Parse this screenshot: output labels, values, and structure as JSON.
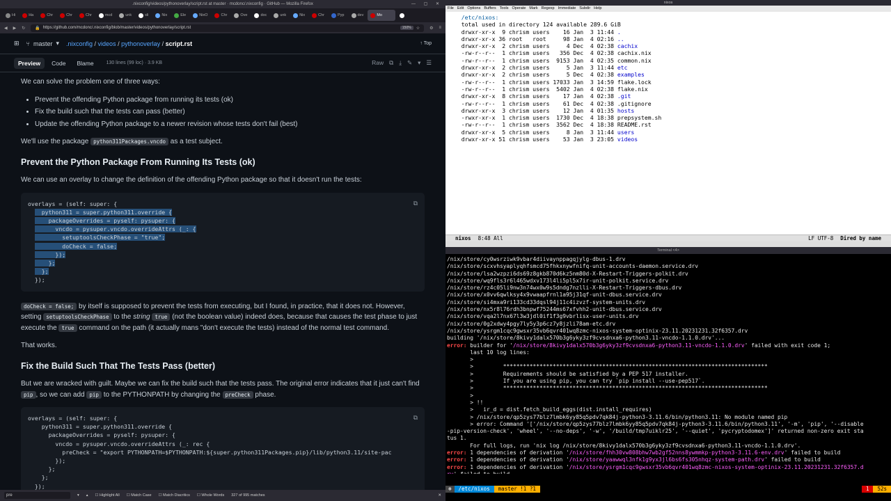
{
  "firefox": {
    "window_title": ".nixconfig/videos/pythonoverlay/script.rst at master · mcdonc/.nixconfig · GitHub — Mozilla Firefox",
    "tabs": [
      "Hi",
      "Ha",
      "Chr",
      "Chr",
      "Chr",
      "mcd",
      "unk",
      "sli",
      "Nix",
      "Ele",
      "NixO",
      "Chr",
      "Ove",
      "doc",
      "unk",
      "Nix",
      "Chr",
      "Pyp",
      "dev",
      "Mo",
      ""
    ],
    "url": "https://github.com/mcdonc/.nixconfig/blob/master/videos/pythonoverlay/script.rst",
    "zoom": "150%"
  },
  "github": {
    "branch": "master",
    "crumbs": [
      ".nixconfig",
      "videos",
      "pythonoverlay"
    ],
    "file": "script.rst",
    "top": "Top",
    "tabs": [
      "Preview",
      "Code",
      "Blame"
    ],
    "meta": "130 lines (99 loc) · 3.9 KB",
    "raw": "Raw"
  },
  "article": {
    "p1": "We can solve the problem one of three ways:",
    "list": [
      "Prevent the offending Python package from running its tests (ok)",
      "Fix the build such that the tests can pass (better)",
      "Update the offending Python package to a newer revision whose tests don't fail (best)"
    ],
    "p2a": "We'll use the package ",
    "p2code": "python311Packages.vncdo",
    "p2b": " as a test subject.",
    "h1": "Prevent the Python Package From Running Its Tests (ok)",
    "p3": "We can use an overlay to change the definition of the offending Python package so that it doesn't run the tests:",
    "code1": [
      "overlays = (self: super: {",
      "    python311 = super.python311.override {",
      "      packageOverrides = pyself: pysuper: {",
      "        vncdo = pysuper.vncdo.overrideAttrs (_: {",
      "          setuptoolsCheckPhase = \"true\";",
      "          doCheck = false;",
      "        });",
      "      };",
      "    };",
      "  });"
    ],
    "p4code1": "doCheck = false;",
    "p4a": " by itself is supposed to prevent the tests from executing, but I found, in practice, that it does not. However, setting ",
    "p4code2": "setuptoolsCheckPhase",
    "p4b": " to the ",
    "p4em": "string",
    "p4code3": "true",
    "p4c": " (not the boolean value) indeed does, because that causes the test phase to just execute the ",
    "p4code4": "true",
    "p4d": " command on the path (it actually mans \"don't execute the tests) instead of the normal test command.",
    "p5": "That works.",
    "h2": "Fix the Build Such That The Tests Pass (better)",
    "p6a": "But we are wracked with guilt. Maybe we can fix the build such that the tests pass. The original error indicates that it just can't find ",
    "p6code1": "pip",
    "p6b": ", so we can add ",
    "p6code2": "pip",
    "p6c": " to the PYTHONPATH by changing the ",
    "p6code3": "preCheck",
    "p6d": " phase.",
    "code2": [
      "overlays = (self: super: {",
      "    python311 = super.python311.override {",
      "      packageOverrides = pyself: pysuper: {",
      "        vncdo = pysuper.vncdo.overrideAttrs (_: rec {",
      "          preCheck = \"export PYTHONPATH=$PYTHONPATH:${super.python311Packages.pip}/lib/python3.11/site-pac",
      "        });",
      "      };",
      "    };",
      "  });"
    ]
  },
  "findbar": {
    "query": "pre",
    "highlight_all": "Highlight All",
    "match_case": "Match Case",
    "match_diacritics": "Match Diacritics",
    "whole_words": "Whole Words",
    "matches": "327 of 995 matches"
  },
  "emacs": {
    "title": "nixos",
    "menu": [
      "File",
      "Edit",
      "Options",
      "Buffers",
      "Tools",
      "Operate",
      "Mark",
      "Regexp",
      "Immediate",
      "Subdir",
      "Help"
    ],
    "header": "/etc/nixos:",
    "total": "total used in directory 124 available 289.6 GiB",
    "rows": [
      {
        "perm": "drwxr-xr-x",
        "n": " 9",
        "u": "chrism",
        "g": "users",
        "size": "   16",
        "date": "Jan  3 11:44",
        "name": ".",
        "dir": true
      },
      {
        "perm": "drwxr-xr-x",
        "n": "36",
        "u": "root  ",
        "g": "root ",
        "size": "   98",
        "date": "Jan  4 02:16",
        "name": "..",
        "dir": true
      },
      {
        "perm": "drwxr-xr-x",
        "n": " 2",
        "u": "chrism",
        "g": "users",
        "size": "    4",
        "date": "Dec  4 02:38",
        "name": "cachix",
        "dir": true
      },
      {
        "perm": "-rw-r--r--",
        "n": " 1",
        "u": "chrism",
        "g": "users",
        "size": "  356",
        "date": "Dec  4 02:38",
        "name": "cachix.nix",
        "dir": false
      },
      {
        "perm": "-rw-r--r--",
        "n": " 1",
        "u": "chrism",
        "g": "users",
        "size": " 9153",
        "date": "Jan  4 02:35",
        "name": "common.nix",
        "dir": false
      },
      {
        "perm": "drwxr-xr-x",
        "n": " 2",
        "u": "chrism",
        "g": "users",
        "size": "    5",
        "date": "Jan  3 11:44",
        "name": "etc",
        "dir": true
      },
      {
        "perm": "drwxr-xr-x",
        "n": " 2",
        "u": "chrism",
        "g": "users",
        "size": "    5",
        "date": "Dec  4 02:38",
        "name": "examples",
        "dir": true
      },
      {
        "perm": "-rw-r--r--",
        "n": " 1",
        "u": "chrism",
        "g": "users",
        "size": "17033",
        "date": "Jan  3 14:59",
        "name": "flake.lock",
        "dir": false
      },
      {
        "perm": "-rw-r--r--",
        "n": " 1",
        "u": "chrism",
        "g": "users",
        "size": " 5402",
        "date": "Jan  4 02:38",
        "name": "flake.nix",
        "dir": false
      },
      {
        "perm": "drwxr-xr-x",
        "n": " 8",
        "u": "chrism",
        "g": "users",
        "size": "   17",
        "date": "Jan  4 02:38",
        "name": ".git",
        "dir": true
      },
      {
        "perm": "-rw-r--r--",
        "n": " 1",
        "u": "chrism",
        "g": "users",
        "size": "   61",
        "date": "Dec  4 02:38",
        "name": ".gitignore",
        "dir": false
      },
      {
        "perm": "drwxr-xr-x",
        "n": " 3",
        "u": "chrism",
        "g": "users",
        "size": "   12",
        "date": "Jan  4 01:35",
        "name": "hosts",
        "dir": true
      },
      {
        "perm": "-rwxr-xr-x",
        "n": " 1",
        "u": "chrism",
        "g": "users",
        "size": " 1730",
        "date": "Dec  4 18:38",
        "name": "prepsystem.sh",
        "dir": false
      },
      {
        "perm": "-rw-r--r--",
        "n": " 1",
        "u": "chrism",
        "g": "users",
        "size": " 3562",
        "date": "Dec  4 18:38",
        "name": "README.rst",
        "dir": false
      },
      {
        "perm": "drwxr-xr-x",
        "n": " 5",
        "u": "chrism",
        "g": "users",
        "size": "    8",
        "date": "Jan  3 11:44",
        "name": "users",
        "dir": true
      },
      {
        "perm": "drwxr-xr-x",
        "n": "51",
        "u": "chrism",
        "g": "users",
        "size": "   53",
        "date": "Jan  3 23:05",
        "name": "videos",
        "dir": true
      }
    ],
    "mode_buffer": "nixos",
    "mode_pos": "8:48 All",
    "mode_enc": "LF UTF-8",
    "mode_major": "Dired by name"
  },
  "terminal": {
    "title": "Terminal <4>",
    "lines": [
      {
        "t": "/nix/store/cy0wsrziwk9vbar4diivaynppagqjylg-dbus-1.drv"
      },
      {
        "t": "/nix/store/scxvhsyaplyqhfsmcd75fhkxnywfnifq-unit-accounts-daemon.service.drv"
      },
      {
        "t": "/nix/store/lsa2wzpzi6ds69z8gkb870d6kz5nm80d-X-Restart-Triggers-polkit.drv"
      },
      {
        "t": "/nix/store/wq9fls3r6l465wdxv173l4li5pl5x7ir-unit-polkit.service.drv"
      },
      {
        "t": "/nix/store/rz4c05li9nw3n74wx0w9s5dndg7nzlli-X-Restart-Triggers-dbus.drv"
      },
      {
        "t": "/nix/store/x0vv6qwlksy4x9vwaapfrnl1a95j31qf-unit-dbus.service.drv"
      },
      {
        "t": "/nix/store/si4mxa9ri133cd33dqsl94j11c4izvzf-system-units.drv"
      },
      {
        "t": "/nix/store/nx5r8l76rdh3bnpwf75244ms67xfvhh2-unit-dbus.service.drv"
      },
      {
        "t": "/nix/store/vqa2l7nx67l3w3jdl0if1f3g9vbrlisx-user-units.drv"
      },
      {
        "t": "/nix/store/0g2xdwy4pgy7ly5y3p6cz7y8jzli78am-etc.drv"
      },
      {
        "t": "/nix/store/ysrgm1cqc9gwsxr35vb6qvr401wq8zmc-nixos-system-optinix-23.11.20231231.32f6357.drv"
      },
      {
        "t": "building '/nix/store/8kivy1dalx570b3g6yky3zf9cvsdnxa6-python3.11-vncdo-1.1.0.drv'..."
      },
      {
        "e": "error: ",
        "t": "builder for '",
        "m": "/nix/store/8kivy1dalx570b3g6yky3zf9cvsdnxa6-python3.11-vncdo-1.1.0.drv",
        "t2": "' failed with exit code 1;"
      },
      {
        "t": "       last 10 log lines:"
      },
      {
        "t": "       >"
      },
      {
        "t": "       >         ********************************************************************************"
      },
      {
        "t": "       >         Requirements should be satisfied by a PEP 517 installer."
      },
      {
        "t": "       >         If you are using pip, you can try `pip install --use-pep517`."
      },
      {
        "t": "       >         ********************************************************************************"
      },
      {
        "t": "       >"
      },
      {
        "t": "       > !!"
      },
      {
        "t": "       >   ir_d = dist.fetch_build_eggs(dist.install_requires)"
      },
      {
        "t": "       > /nix/store/qp5zys77blz7lmbk6yy85q5pdv7qk84j-python3-3.11.6/bin/python3.11: No module named pip"
      },
      {
        "t": "       > error: Command '['/nix/store/qp5zys77blz7lmbk6yy85q5pdv7qk84j-python3-3.11.6/bin/python3.11', '-m', 'pip', '--disable"
      },
      {
        "t": "-pip-version-check', 'wheel', '--no-deps', '-w', '/build/tmp7uiklr25', '--quiet', 'pycryptodomex']' returned non-zero exit sta"
      },
      {
        "t": "tus 1."
      },
      {
        "t": "       For full logs, run 'nix log /nix/store/8kivy1dalx570b3g6yky3zf9cvsdnxa6-python3.11-vncdo-1.1.0.drv'."
      },
      {
        "e": "error: ",
        "t": "1 dependencies of derivation '",
        "m": "/nix/store/fhh30vw808bhw7wb2gf52nns8ywmmkp-python3-3.11.6-env.drv",
        "t2": "' failed to build"
      },
      {
        "e": "error: ",
        "t": "1 dependencies of derivation '",
        "m": "/nix/store/yaawwql3nfk1g9yx3jl6bs6fs305nhqz-system-path.drv",
        "t2": "' failed to build"
      },
      {
        "e": "error: ",
        "t": "1 dependencies of derivation '",
        "m": "/nix/store/ysrgm1cqc9gwsxr35vb6qvr401wq8zmc-nixos-system-optinix-23.11.20231231.32f6357.d",
        "t2": ""
      },
      {
        "m": "rv",
        "t2": "' failed to build"
      }
    ],
    "prompt_path": "/etc/nixos",
    "prompt_git": "master !1 ?1",
    "prompt_status": "1",
    "prompt_time": "52s"
  }
}
